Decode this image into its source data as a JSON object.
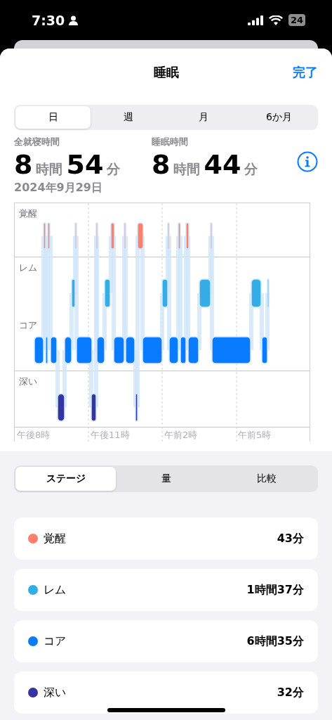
{
  "status_bar": {
    "time": "7:30",
    "battery": "24"
  },
  "header": {
    "title": "睡眠",
    "done": "完了"
  },
  "range_tabs": [
    {
      "label": "日",
      "selected": true
    },
    {
      "label": "週",
      "selected": false
    },
    {
      "label": "月",
      "selected": false
    },
    {
      "label": "6か月",
      "selected": false
    }
  ],
  "stats": [
    {
      "label": "全就寝時間",
      "hours": "8",
      "hours_unit": "時間",
      "minutes": "54",
      "minutes_unit": "分"
    },
    {
      "label": "睡眠時間",
      "hours": "8",
      "hours_unit": "時間",
      "minutes": "44",
      "minutes_unit": "分"
    }
  ],
  "date": "2024年9月29日",
  "chart": {
    "stages": [
      "覚醒",
      "レム",
      "コア",
      "深い"
    ],
    "times": [
      "午後8時",
      "午後11時",
      "午前2時",
      "午前5時"
    ]
  },
  "view_tabs": [
    {
      "label": "ステージ",
      "selected": true
    },
    {
      "label": "量",
      "selected": false
    },
    {
      "label": "比較",
      "selected": false
    }
  ],
  "legend": [
    {
      "label": "覚醒",
      "value": "43分",
      "color": "#fe7f6a"
    },
    {
      "label": "レム",
      "value": "1時間37分",
      "color": "#33ade4"
    },
    {
      "label": "コア",
      "value": "6時間35分",
      "color": "#087bfe"
    },
    {
      "label": "深い",
      "value": "32分",
      "color": "#3634a3"
    }
  ]
}
